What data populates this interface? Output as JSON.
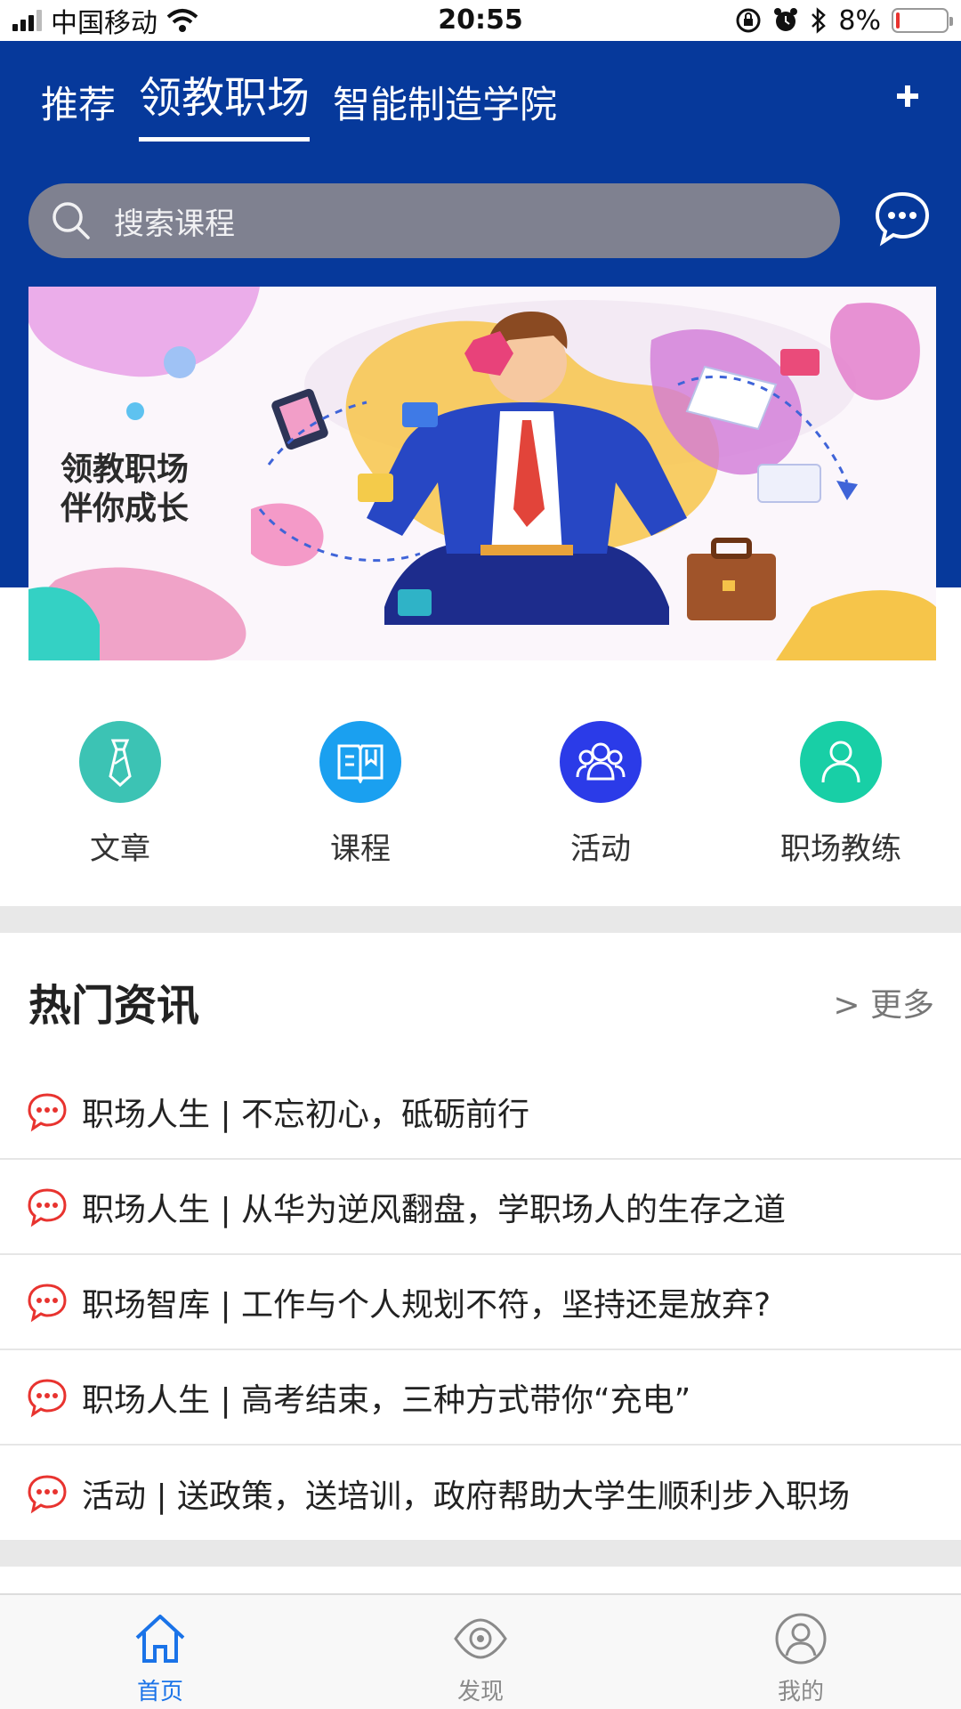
{
  "status_bar": {
    "carrier": "中国移动",
    "time": "20:55",
    "battery": "8%",
    "battery_level": 0.08,
    "battery_color": "#e8332f"
  },
  "header": {
    "tabs": [
      {
        "label": "推荐",
        "active": false
      },
      {
        "label": "领教职场",
        "active": true
      },
      {
        "label": "智能制造学院",
        "active": false
      }
    ],
    "add_icon": "plus-icon",
    "background_color": "#06399b"
  },
  "search": {
    "placeholder": "搜索课程",
    "icon": "search-icon"
  },
  "message_icon": "chat-bubble-icon",
  "banner": {
    "title_line1": "领教职场",
    "title_line2": "伴你成长"
  },
  "quick_nav": [
    {
      "label": "文章",
      "icon": "tie-icon",
      "color": "#3cc3b4"
    },
    {
      "label": "课程",
      "icon": "book-icon",
      "color": "#1aa0f0"
    },
    {
      "label": "活动",
      "icon": "group-icon",
      "color": "#2b3be8"
    },
    {
      "label": "职场教练",
      "icon": "person-icon",
      "color": "#18cfa6"
    }
  ],
  "hot_news": {
    "title": "热门资讯",
    "more": "> 更多",
    "icon_color": "#e8332f",
    "items": [
      "职场人生 | 不忘初心，砥砺前行",
      "职场人生 | 从华为逆风翻盘，学职场人的生存之道",
      "职场智库 | 工作与个人规划不符，坚持还是放弃?",
      "职场人生 | 高考结束，三种方式带你“充电”",
      "活动 | 送政策，送培训，政府帮助大学生顺利步入职场"
    ]
  },
  "bottom_nav": [
    {
      "label": "首页",
      "icon": "home-icon",
      "active": true
    },
    {
      "label": "发现",
      "icon": "eye-icon",
      "active": false
    },
    {
      "label": "我的",
      "icon": "user-icon",
      "active": false
    }
  ],
  "active_color": "#1a73e8"
}
